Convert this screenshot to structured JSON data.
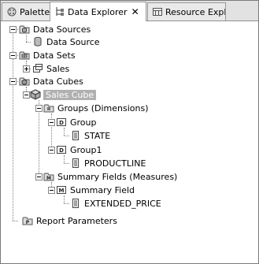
{
  "tabs": [
    {
      "label": "Palette",
      "icon": "palette-icon"
    },
    {
      "label": "Data Explorer",
      "icon": "data-explorer-icon",
      "close": "✕"
    },
    {
      "label": "Resource Expl",
      "icon": "resource-explorer-icon"
    }
  ],
  "tree": {
    "data_sources": {
      "label": "Data Sources",
      "child": "Data Source"
    },
    "data_sets": {
      "label": "Data Sets",
      "child": "Sales"
    },
    "data_cubes": {
      "label": "Data Cubes"
    },
    "sales_cube": {
      "label": "Sales Cube"
    },
    "groups": {
      "label": "Groups (Dimensions)"
    },
    "group": {
      "label": "Group",
      "level": "STATE"
    },
    "group1": {
      "label": "Group1",
      "level": "PRODUCTLINE"
    },
    "summary_fields": {
      "label": "Summary Fields (Measures)"
    },
    "summary_field": {
      "label": "Summary Field",
      "measure": "EXTENDED_PRICE"
    },
    "report_parameters": {
      "label": "Report Parameters"
    }
  }
}
